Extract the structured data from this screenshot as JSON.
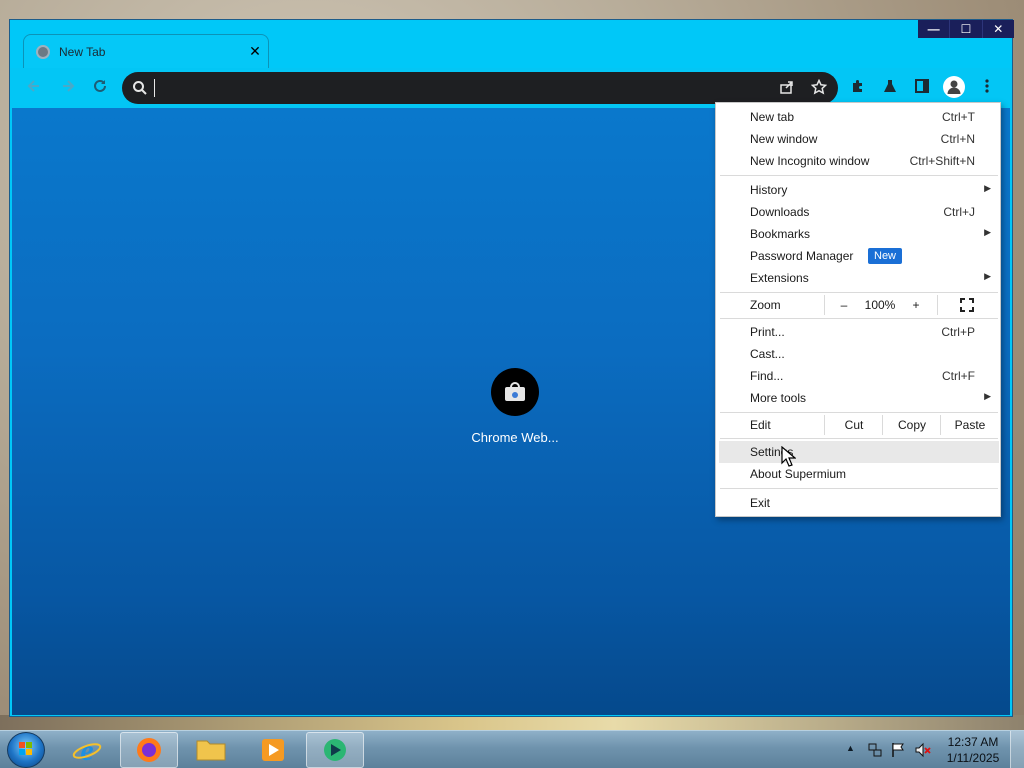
{
  "window": {
    "controls": {
      "minimize": "—",
      "maximize": "☐",
      "close": "✕"
    }
  },
  "tab": {
    "title": "New Tab",
    "close": "✕"
  },
  "omnibox": {
    "value": "",
    "placeholder": ""
  },
  "content": {
    "shortcut_label": "Chrome Web..."
  },
  "menu": {
    "items_group1": [
      {
        "label": "New tab",
        "shortcut": "Ctrl+T"
      },
      {
        "label": "New window",
        "shortcut": "Ctrl+N"
      },
      {
        "label": "New Incognito window",
        "shortcut": "Ctrl+Shift+N"
      }
    ],
    "history": "History",
    "downloads": {
      "label": "Downloads",
      "shortcut": "Ctrl+J"
    },
    "bookmarks": "Bookmarks",
    "password_manager": {
      "label": "Password Manager",
      "badge": "New"
    },
    "extensions": "Extensions",
    "zoom": {
      "label": "Zoom",
      "minus": "–",
      "value": "100%",
      "plus": "+"
    },
    "print": {
      "label": "Print...",
      "shortcut": "Ctrl+P"
    },
    "cast": "Cast...",
    "find": {
      "label": "Find...",
      "shortcut": "Ctrl+F"
    },
    "more_tools": "More tools",
    "edit": {
      "label": "Edit",
      "cut": "Cut",
      "copy": "Copy",
      "paste": "Paste"
    },
    "settings": "Settings",
    "about": "About Supermium",
    "exit": "Exit",
    "arrow": "▶"
  },
  "taskbar": {
    "clock_time": "12:37 AM",
    "clock_date": "1/11/2025",
    "tray_arrow": "▲"
  },
  "colors": {
    "window_frame": "#00c8f8",
    "omnibox_bg": "#1e1f22",
    "content_bg": "#0b6cc0",
    "badge_bg": "#1a6fd6"
  }
}
